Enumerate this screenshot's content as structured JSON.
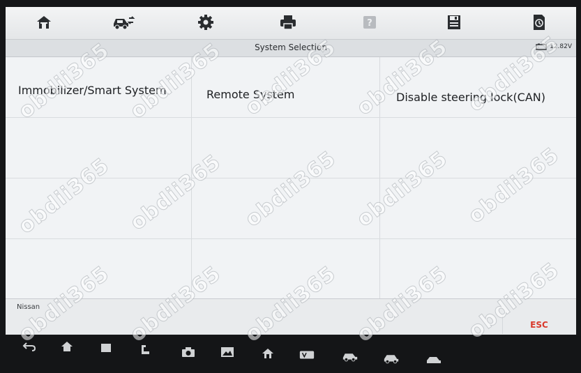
{
  "header": {
    "title": "System Selection",
    "top_left_text": "",
    "battery_voltage": "12.82V"
  },
  "toolbar": {
    "items": [
      {
        "name": "home",
        "icon": "home-icon"
      },
      {
        "name": "vehicle-swap",
        "icon": "car-swap-icon"
      },
      {
        "name": "settings",
        "icon": "gear-icon"
      },
      {
        "name": "print",
        "icon": "printer-icon"
      },
      {
        "name": "help",
        "icon": "help-icon"
      },
      {
        "name": "save",
        "icon": "save-icon"
      },
      {
        "name": "data-logging",
        "icon": "data-log-icon"
      }
    ]
  },
  "systems": [
    {
      "label": "Immobilizer/Smart System"
    },
    {
      "label": "Remote System"
    },
    {
      "label": "Disable steering lock(CAN)"
    }
  ],
  "footer": {
    "vehicle": "Nissan",
    "esc_label": "ESC"
  },
  "watermark": {
    "text": "obdii365"
  },
  "colors": {
    "toolbar_bg": "#eceef0",
    "grid_bg": "#f1f3f5",
    "esc_red": "#d9392c",
    "bezel": "#151618"
  }
}
